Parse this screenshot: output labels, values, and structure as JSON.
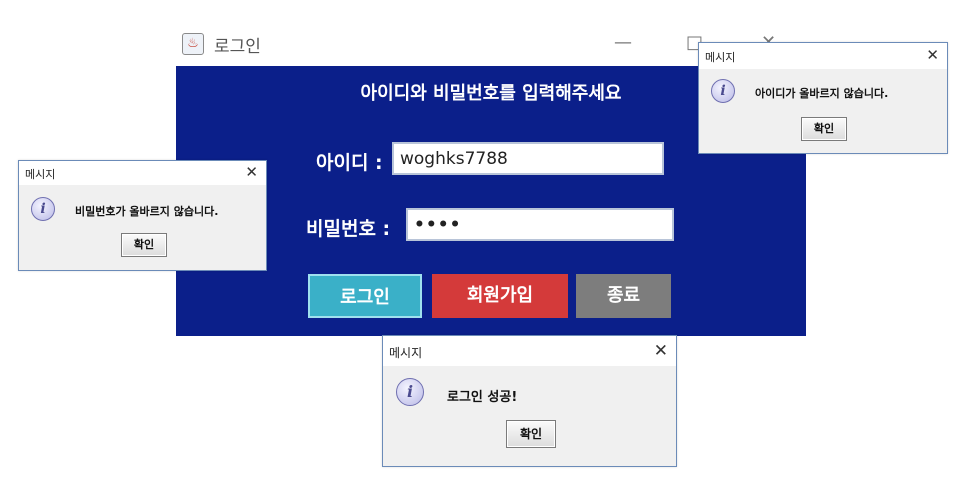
{
  "main_window": {
    "title": "로그인",
    "minimize": "—",
    "maximize": "□",
    "close": "✕",
    "instruction": "아이디와 비밀번호를 입력해주세요",
    "id_label": "아이디 :",
    "id_value": "woghks7788",
    "pw_label": "비밀번호 :",
    "pw_value": "••••",
    "buttons": {
      "login": "로그인",
      "signup": "회원가입",
      "exit": "종료"
    },
    "colors": {
      "background": "#0b1f8a",
      "login_button": "#3ab0c8",
      "signup_button": "#d43a3a",
      "exit_button": "#7d7d7d"
    }
  },
  "dialogs": {
    "id_error": {
      "title": "메시지",
      "close": "✕",
      "icon": "info-icon",
      "message": "아이디가 올바르지 않습니다.",
      "ok": "확인"
    },
    "pw_error": {
      "title": "메시지",
      "close": "✕",
      "icon": "info-icon",
      "message": "비밀번호가 올바르지 않습니다.",
      "ok": "확인"
    },
    "success": {
      "title": "메시지",
      "close": "✕",
      "icon": "info-icon",
      "message": "로그인 성공!",
      "ok": "확인"
    }
  }
}
